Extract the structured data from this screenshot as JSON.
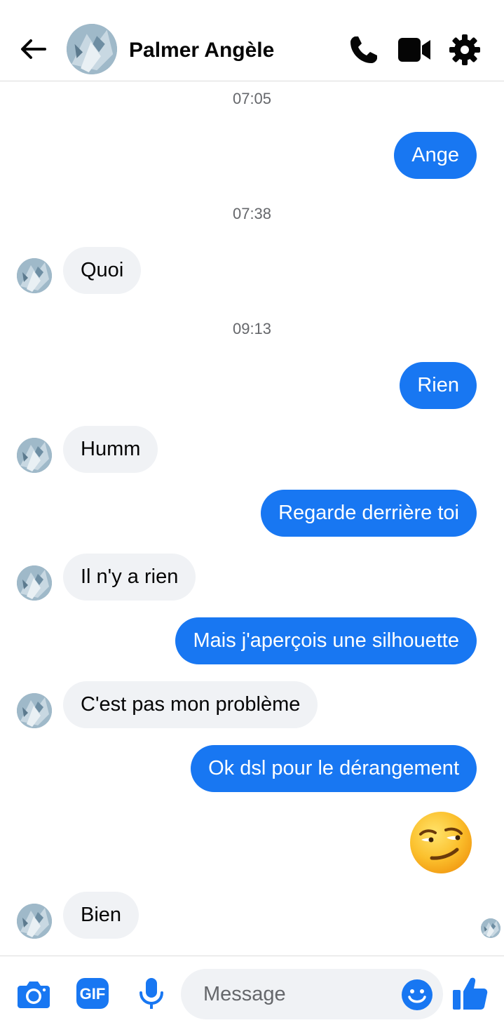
{
  "header": {
    "contact_name": "Palmer Angèle",
    "icons": [
      "back-arrow-icon",
      "phone-icon",
      "video-camera-icon",
      "gear-icon"
    ]
  },
  "colors": {
    "accent": "#1877f2",
    "incoming_bubble": "#f0f2f5",
    "timestamp": "#65676b"
  },
  "conversation": {
    "timestamps": [
      "07:05",
      "07:38",
      "09:13"
    ],
    "messages": [
      {
        "direction": "outgoing",
        "text": "Ange"
      },
      {
        "direction": "incoming",
        "text": "Quoi"
      },
      {
        "direction": "outgoing",
        "text": "Rien"
      },
      {
        "direction": "incoming",
        "text": "Humm"
      },
      {
        "direction": "outgoing",
        "text": "Regarde derrière toi"
      },
      {
        "direction": "incoming",
        "text": "Il n'y a rien"
      },
      {
        "direction": "outgoing",
        "text": "Mais j'aperçois une silhouette"
      },
      {
        "direction": "incoming",
        "text": "C'est pas mon problème"
      },
      {
        "direction": "outgoing",
        "text": "Ok dsl pour le dérangement"
      },
      {
        "direction": "outgoing",
        "emoji": "smirking-face"
      },
      {
        "direction": "incoming",
        "text": "Bien"
      }
    ]
  },
  "composer": {
    "placeholder": "Message",
    "gif_label": "GIF",
    "icons": [
      "camera-icon",
      "gif-icon",
      "microphone-icon",
      "emoji-icon",
      "thumbs-up-icon"
    ]
  }
}
